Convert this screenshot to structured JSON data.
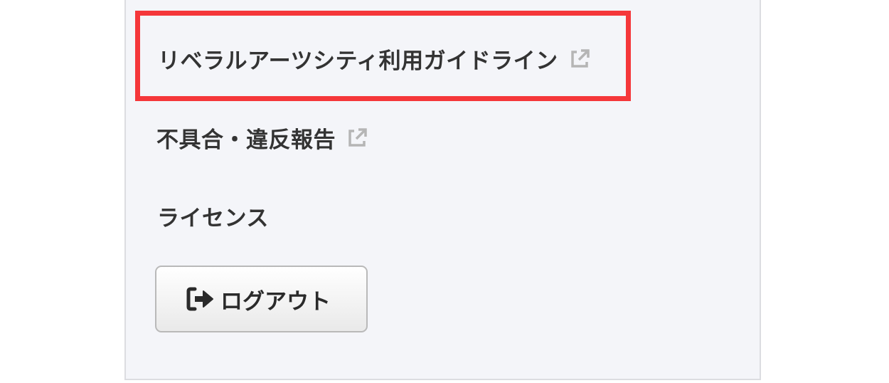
{
  "menu": {
    "items": [
      {
        "label": "リベラルアーツシティ利用ガイドライン",
        "icon": "external-link-icon"
      },
      {
        "label": "不具合・違反報告",
        "icon": "external-link-icon"
      },
      {
        "label": "ライセンス"
      }
    ]
  },
  "logout": {
    "label": "ログアウト",
    "icon": "sign-out-icon"
  },
  "colors": {
    "panel_background": "#f4f5f9",
    "highlight_border": "#f5373a",
    "text": "#333333",
    "icon_gray": "#b5b5b5"
  }
}
